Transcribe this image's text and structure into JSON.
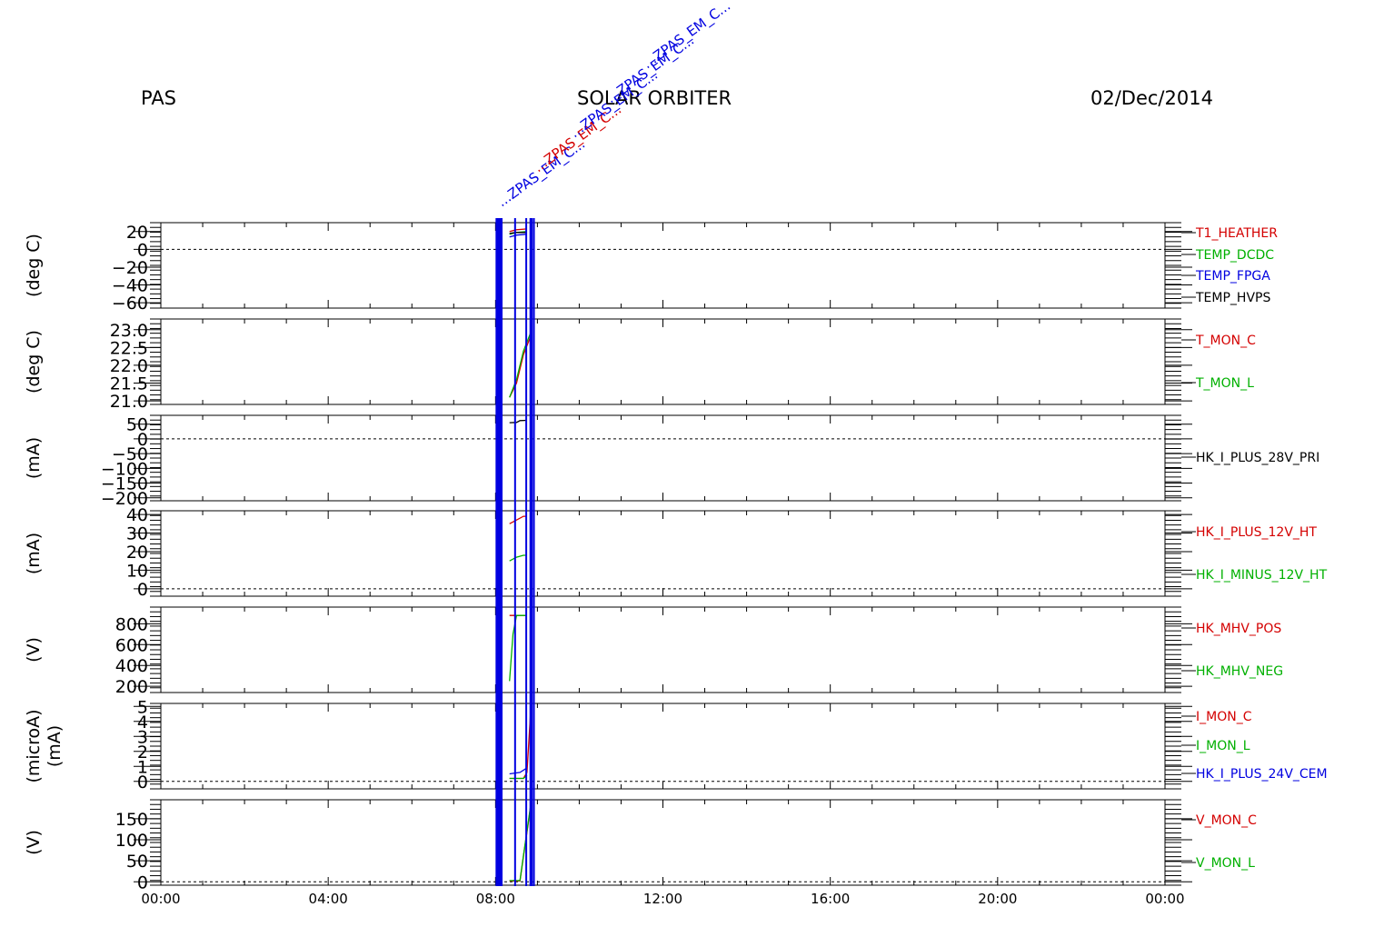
{
  "header": {
    "left": "PAS",
    "center": "SOLAR ORBITER",
    "right": "02/Dec/2014"
  },
  "colors": {
    "red": "#d40000",
    "green": "#00b000",
    "blue": "#0000e0",
    "black": "#000000"
  },
  "chart_data": [
    {
      "type": "line",
      "ylabel": "(deg C)",
      "ylim": [
        -66,
        30
      ],
      "yticks": [
        -60,
        -40,
        -20,
        0,
        20
      ],
      "ytick_labels": [
        "−60",
        "−40",
        "−20",
        "0",
        "20"
      ],
      "zero_line": true,
      "series": [
        {
          "name": "T1_HEATHER",
          "color": "red",
          "x": [
            "08:20",
            "08:30",
            "08:45"
          ],
          "values": [
            20,
            22,
            23
          ]
        },
        {
          "name": "TEMP_DCDC",
          "color": "green",
          "x": [
            "08:20",
            "08:30",
            "08:45"
          ],
          "values": [
            17,
            19,
            20
          ]
        },
        {
          "name": "TEMP_FPGA",
          "color": "blue",
          "x": [
            "08:20",
            "08:30",
            "08:45"
          ],
          "values": [
            14,
            16,
            17
          ]
        },
        {
          "name": "TEMP_HVPS",
          "color": "black",
          "x": [
            "08:20",
            "08:30",
            "08:45"
          ],
          "values": [
            18,
            19,
            19
          ]
        }
      ]
    },
    {
      "type": "line",
      "ylabel": "(deg C)",
      "ylim": [
        20.9,
        23.3
      ],
      "yticks": [
        21.0,
        21.5,
        22.0,
        22.5,
        23.0
      ],
      "ytick_labels": [
        "21.0",
        "21.5",
        "22.0",
        "22.5",
        "23.0"
      ],
      "zero_line": false,
      "series": [
        {
          "name": "T_MON_C",
          "color": "red",
          "x": [
            "08:20",
            "08:30",
            "08:40",
            "08:50"
          ],
          "values": [
            21.1,
            21.5,
            22.3,
            22.8
          ]
        },
        {
          "name": "T_MON_L",
          "color": "green",
          "x": [
            "08:20",
            "08:30",
            "08:40",
            "08:50"
          ],
          "values": [
            21.1,
            21.6,
            22.4,
            22.9
          ]
        }
      ]
    },
    {
      "type": "line",
      "ylabel": "(mA)",
      "ylim": [
        -210,
        80
      ],
      "yticks": [
        -200,
        -150,
        -100,
        -50,
        0,
        50
      ],
      "ytick_labels": [
        "−200",
        "−150",
        "−100",
        "−50",
        "0",
        "50"
      ],
      "zero_line": true,
      "series": [
        {
          "name": "HK_I_PLUS_28V_PRI",
          "color": "black",
          "x": [
            "08:20",
            "08:30",
            "08:35",
            "08:45"
          ],
          "values": [
            55,
            56,
            62,
            63
          ]
        }
      ]
    },
    {
      "type": "line",
      "ylabel": "(mA)",
      "ylim": [
        -4,
        42
      ],
      "yticks": [
        0,
        10,
        20,
        30,
        40
      ],
      "ytick_labels": [
        "0",
        "10",
        "20",
        "30",
        "40"
      ],
      "zero_line": true,
      "series": [
        {
          "name": "HK_I_PLUS_12V_HT",
          "color": "red",
          "x": [
            "08:20",
            "08:30",
            "08:40",
            "08:45"
          ],
          "values": [
            35,
            37,
            39,
            39
          ]
        },
        {
          "name": "HK_I_MINUS_12V_HT",
          "color": "green",
          "x": [
            "08:20",
            "08:30",
            "08:40",
            "08:45"
          ],
          "values": [
            15,
            17,
            18,
            18
          ]
        }
      ]
    },
    {
      "type": "line",
      "ylabel": "(V)",
      "ylim": [
        140,
        960
      ],
      "yticks": [
        200,
        400,
        600,
        800
      ],
      "ytick_labels": [
        "200",
        "400",
        "600",
        "800"
      ],
      "zero_line": false,
      "series": [
        {
          "name": "HK_MHV_POS",
          "color": "red",
          "x": [
            "08:20",
            "08:30",
            "08:45"
          ],
          "values": [
            880,
            880,
            880
          ]
        },
        {
          "name": "HK_MHV_NEG",
          "color": "green",
          "x": [
            "08:20",
            "08:25",
            "08:30",
            "08:45"
          ],
          "values": [
            250,
            700,
            880,
            880
          ]
        }
      ]
    },
    {
      "type": "line",
      "ylabel": "(microA)",
      "ylabel2": "(mA)",
      "ylim": [
        -0.5,
        5.2
      ],
      "yticks": [
        0,
        1,
        2,
        3,
        4,
        5
      ],
      "ytick_labels": [
        "0",
        "1",
        "2",
        "3",
        "4",
        "5"
      ],
      "zero_line": true,
      "series": [
        {
          "name": "I_MON_C",
          "color": "red",
          "x": [
            "08:20",
            "08:40",
            "08:45",
            "08:50"
          ],
          "values": [
            0.2,
            0.2,
            0.6,
            4.4
          ]
        },
        {
          "name": "I_MON_L",
          "color": "green",
          "x": [
            "08:20",
            "08:40",
            "08:45"
          ],
          "values": [
            0.2,
            0.2,
            0.4
          ]
        },
        {
          "name": "HK_I_PLUS_24V_CEM",
          "color": "blue",
          "x": [
            "08:20",
            "08:35",
            "08:45"
          ],
          "values": [
            0.5,
            0.6,
            0.9
          ]
        }
      ]
    },
    {
      "type": "line",
      "ylabel": "(V)",
      "ylim": [
        -8,
        195
      ],
      "yticks": [
        0,
        50,
        100,
        150
      ],
      "ytick_labels": [
        "0",
        "50",
        "100",
        "150"
      ],
      "zero_line": true,
      "series": [
        {
          "name": "V_MON_C",
          "color": "red",
          "x": [
            "08:20",
            "08:35",
            "08:40",
            "08:50"
          ],
          "values": [
            2,
            2,
            60,
            175
          ]
        },
        {
          "name": "V_MON_L",
          "color": "green",
          "x": [
            "08:20",
            "08:35",
            "08:40",
            "08:50"
          ],
          "values": [
            3,
            3,
            62,
            178
          ]
        }
      ]
    }
  ],
  "x_axis": {
    "ticks": [
      "00:00",
      "04:00",
      "08:00",
      "12:00",
      "16:00",
      "20:00",
      "00:00"
    ]
  },
  "markers": {
    "solid_band": [
      "08:00",
      "08:10"
    ],
    "lines": [
      "08:28",
      "08:44",
      "08:50",
      "08:52",
      "08:55"
    ]
  },
  "annotations": {
    "items": [
      "...ZPAS_EM_C...",
      "...ZPAS_EM_C...",
      "...ZPAS_EM_C...",
      "...ZPAS_EM_C...",
      "...ZPAS_EM_C..."
    ]
  }
}
